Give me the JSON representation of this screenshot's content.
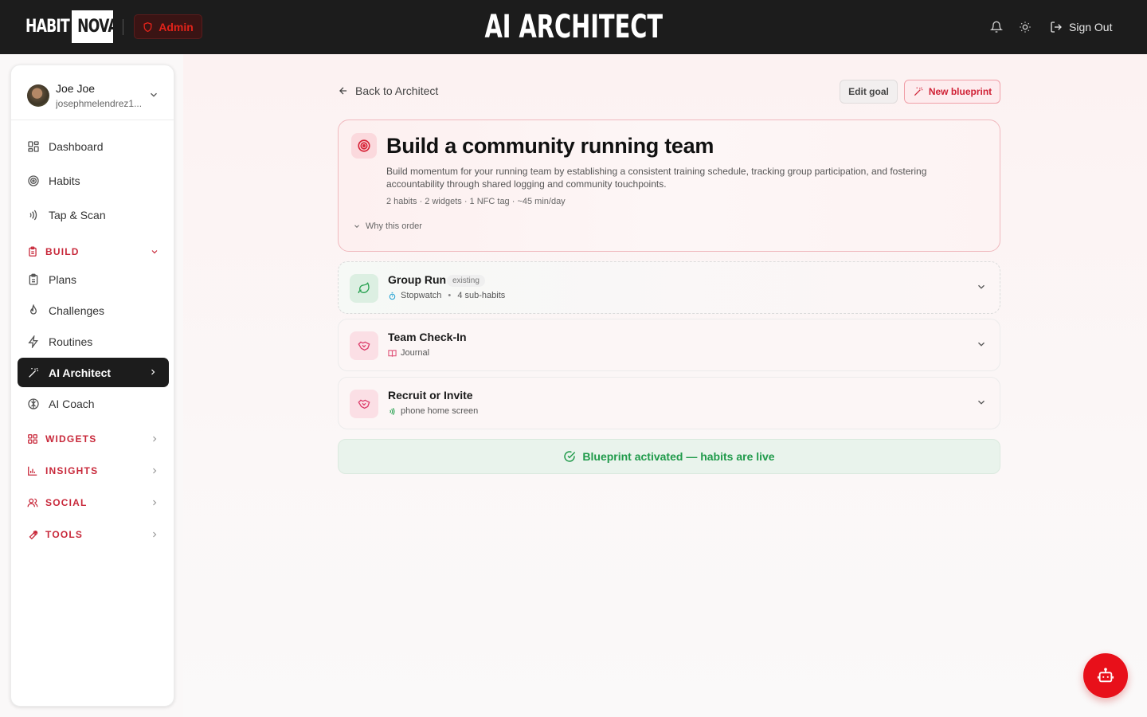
{
  "brand": {
    "logo_left": "HABIT",
    "logo_right": "NOVA",
    "admin_label": "Admin",
    "title": "AI ARCHITECT"
  },
  "header": {
    "sign_out": "Sign Out",
    "icons": [
      "bell-icon",
      "sun-icon",
      "sign-out-icon"
    ]
  },
  "user": {
    "name": "Joe Joe",
    "email": "josephmelendrez1..."
  },
  "nav": {
    "dashboard": "Dashboard",
    "habits": "Habits",
    "tap_scan": "Tap & Scan",
    "build": "BUILD",
    "plans": "Plans",
    "challenges": "Challenges",
    "routines": "Routines",
    "ai_architect": "AI Architect",
    "ai_coach": "AI Coach",
    "widgets": "WIDGETS",
    "insights": "INSIGHTS",
    "social": "SOCIAL",
    "tools": "TOOLS"
  },
  "main": {
    "back": "Back to Architect",
    "edit_goal": "Edit goal",
    "new_blueprint": "New blueprint",
    "goal": {
      "title": "Build a community running team",
      "description": "Build momentum for your running team by establishing a consistent training schedule, tracking group participation, and fostering accountability through shared logging and community touchpoints.",
      "meta": "2 habits · 2 widgets · 1 NFC tag · ~45 min/day",
      "why": "Why this order"
    },
    "habits": [
      {
        "title": "Group Run",
        "tag": "existing",
        "widget": "Stopwatch",
        "extra": "4 sub-habits"
      },
      {
        "title": "Team Check-In",
        "widget": "Journal"
      },
      {
        "title": "Recruit or Invite",
        "widget": "phone home screen"
      }
    ],
    "activated": "Blueprint activated — habits are live"
  },
  "colors": {
    "accent": "#e8101a",
    "brand_red": "#c8283a",
    "success": "#1f9a4a",
    "topbar": "#1c1c1c"
  }
}
